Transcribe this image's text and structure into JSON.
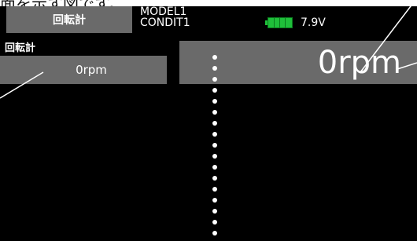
{
  "caption": "面を示す図です。",
  "header": {
    "title_tab": "回転計",
    "model": "MODEL1",
    "condition": "CONDIT1",
    "battery_voltage": "7.9V"
  },
  "left_panel": {
    "label": "回転計",
    "value": "0rpm"
  },
  "right_panel": {
    "value": "0rpm"
  },
  "colors": {
    "screen_bg": "#000000",
    "panel_gray": "#6a6a6a",
    "battery_green": "#1fbf3a",
    "text": "#ffffff"
  }
}
